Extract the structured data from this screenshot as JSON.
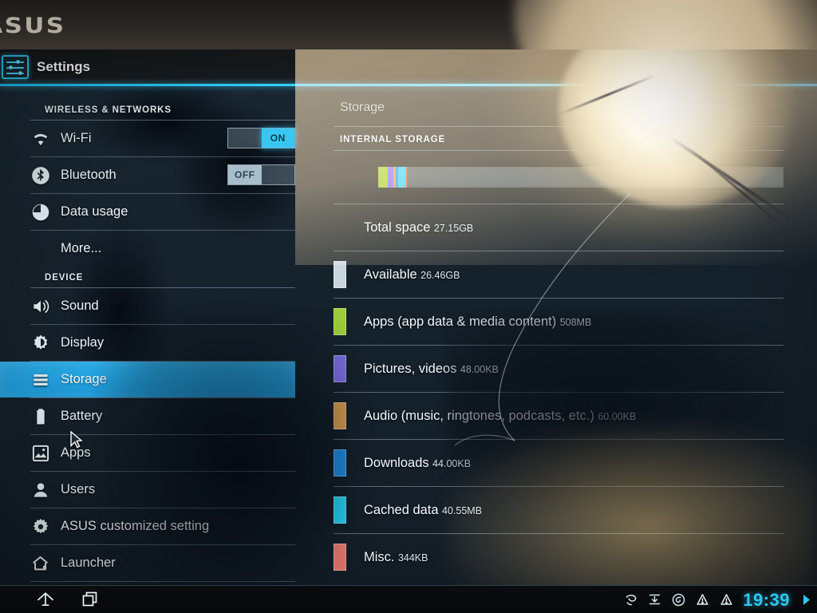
{
  "device": {
    "brand_logo": "ASUS"
  },
  "header": {
    "title": "Settings",
    "icon": "settings-sliders-icon"
  },
  "sidebar": {
    "sections": [
      {
        "label": "WIRELESS & NETWORKS",
        "items": [
          {
            "label": "Wi-Fi",
            "icon": "wifi-icon",
            "toggle": {
              "state": "ON",
              "on": true
            }
          },
          {
            "label": "Bluetooth",
            "icon": "bluetooth-icon",
            "toggle": {
              "state": "OFF",
              "on": false
            }
          },
          {
            "label": "Data usage",
            "icon": "data-usage-icon"
          },
          {
            "label": "More...",
            "icon": null
          }
        ]
      },
      {
        "label": "DEVICE",
        "items": [
          {
            "label": "Sound",
            "icon": "speaker-icon"
          },
          {
            "label": "Display",
            "icon": "brightness-icon"
          },
          {
            "label": "Storage",
            "icon": "storage-bars-icon",
            "selected": true
          },
          {
            "label": "Battery",
            "icon": "battery-icon"
          },
          {
            "label": "Apps",
            "icon": "apps-image-icon"
          },
          {
            "label": "Users",
            "icon": "user-icon"
          },
          {
            "label": "ASUS customized setting",
            "icon": "gear-icon"
          },
          {
            "label": "Launcher",
            "icon": "home-gear-icon"
          }
        ]
      }
    ]
  },
  "content": {
    "title": "Storage",
    "section_label": "INTERNAL STORAGE",
    "rows": [
      {
        "name": "Total space",
        "size": "27.15GB",
        "color": null
      },
      {
        "name": "Available",
        "size": "26.46GB",
        "color": "#c9d6de"
      },
      {
        "name": "Apps (app data & media content)",
        "size": "508MB",
        "color": "#9fce3a"
      },
      {
        "name": "Pictures, videos",
        "size": "48.00KB",
        "color": "#7b6fe2"
      },
      {
        "name": "Audio (music, ringtones, podcasts, etc.)",
        "size": "60.00KB",
        "color": "#dba04f"
      },
      {
        "name": "Downloads",
        "size": "44.00KB",
        "color": "#1e90e8"
      },
      {
        "name": "Cached data",
        "size": "40.55MB",
        "color": "#25d3f0"
      },
      {
        "name": "Misc.",
        "size": "344KB",
        "color": "#e8776f"
      }
    ]
  },
  "chart_data": {
    "type": "bar",
    "title": "Internal storage usage",
    "subtitle": "Stacked usage bar for 27.15GB total space",
    "categories": [
      "Apps (app data & media content)",
      "Pictures, videos",
      "Audio (music, ringtones, podcasts, etc.)",
      "Downloads",
      "Cached data",
      "Misc.",
      "Available"
    ],
    "values_label": [
      "508MB",
      "48.00KB",
      "60.00KB",
      "44.00KB",
      "40.55MB",
      "344KB",
      "26.46GB"
    ],
    "values_gb": [
      0.508,
      4.8e-05,
      6e-05,
      4.4e-05,
      0.04055,
      0.000344,
      26.46
    ],
    "percent_of_total": [
      1.87,
      0.0002,
      0.0002,
      0.0002,
      0.15,
      0.001,
      97.46
    ],
    "colors": [
      "#9fce3a",
      "#7b6fe2",
      "#dba04f",
      "#1e90e8",
      "#25d3f0",
      "#e8776f",
      "#aab8c2"
    ],
    "total_label": "Total space",
    "total_value": "27.15GB",
    "xlabel": "",
    "ylabel": "",
    "legend": "inline-list",
    "grid": false
  },
  "navbar": {
    "buttons": [
      {
        "name": "home",
        "icon": "home-icon"
      },
      {
        "name": "recents",
        "icon": "recent-apps-icon"
      }
    ],
    "status_icons": [
      "screenshot-icon",
      "download-icon",
      "browser-icon",
      "warning-icon",
      "warning-icon"
    ],
    "clock": "19:39"
  },
  "colors": {
    "accent": "#2ec8f2",
    "selected_row": "#2aaeea",
    "toggle_on": "#3ac6f2"
  }
}
